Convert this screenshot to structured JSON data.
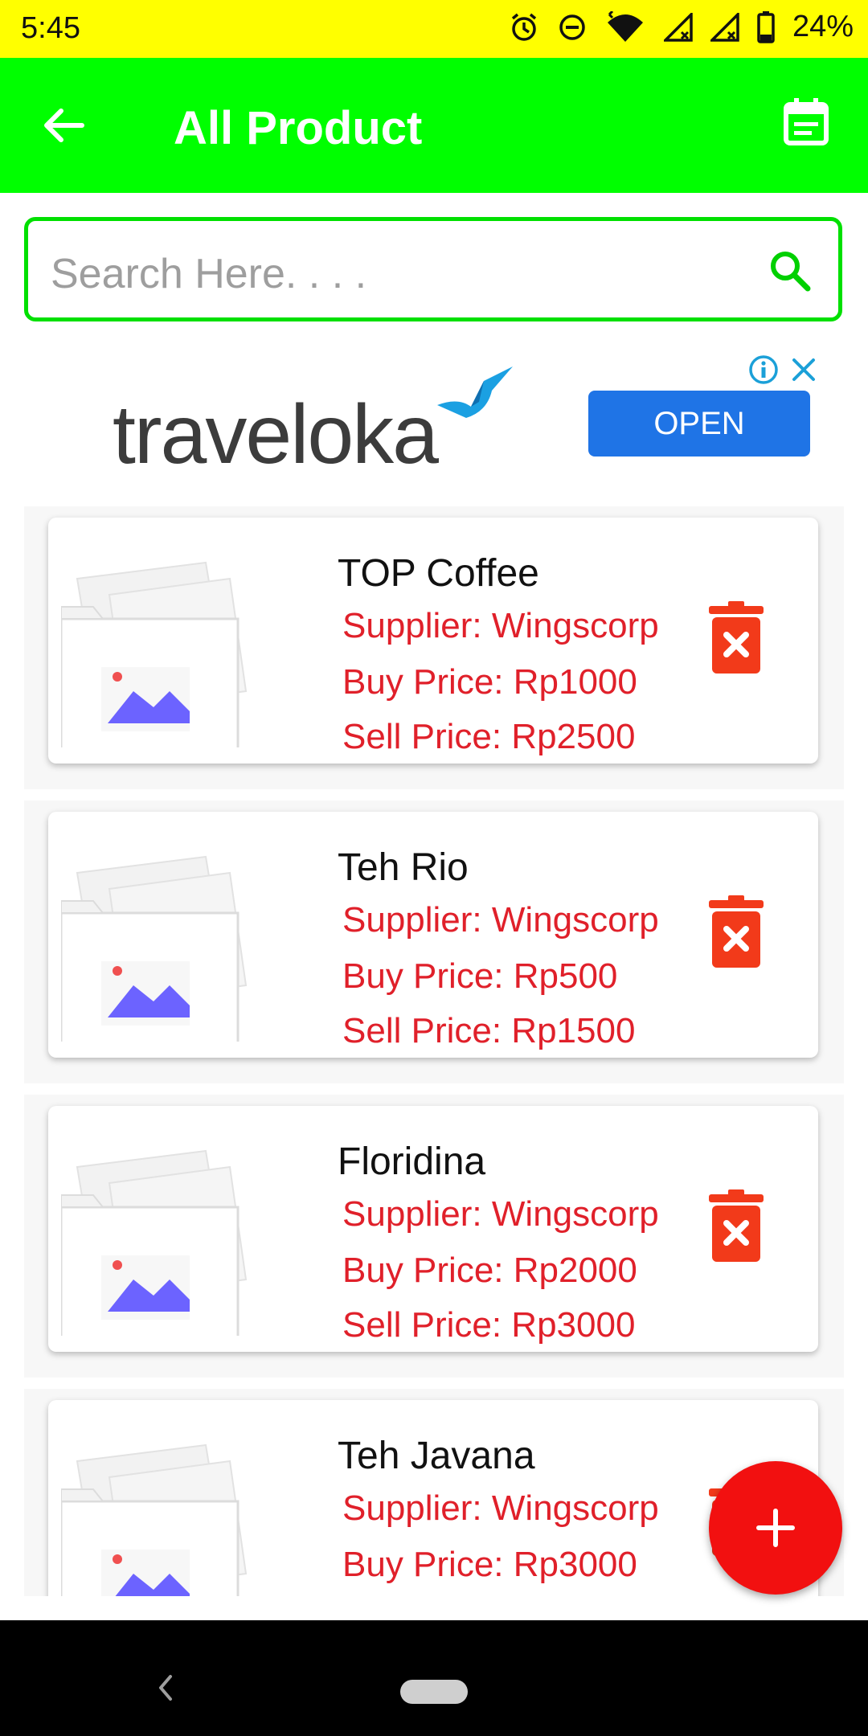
{
  "status_bar": {
    "time": "5:45",
    "battery": "24%"
  },
  "app_bar": {
    "title": "All Product",
    "back_icon": "arrow-back-icon",
    "action_icon": "calendar-list-icon",
    "bg_color": "#00ff00"
  },
  "search": {
    "placeholder": "Search Here. . . ."
  },
  "ad": {
    "brand": "traveloka",
    "button_label": "OPEN"
  },
  "products": [
    {
      "name": "TOP Coffee",
      "supplier": "Supplier: Wingscorp",
      "buy_price": "Buy Price: Rp1000",
      "sell_price": "Sell Price: Rp2500"
    },
    {
      "name": "Teh Rio",
      "supplier": "Supplier: Wingscorp",
      "buy_price": "Buy Price: Rp500",
      "sell_price": "Sell Price: Rp1500"
    },
    {
      "name": "Floridina",
      "supplier": "Supplier: Wingscorp",
      "buy_price": "Buy Price: Rp2000",
      "sell_price": "Sell Price: Rp3000"
    },
    {
      "name": "Teh Javana",
      "supplier": "Supplier: Wingscorp",
      "buy_price": "Buy Price: Rp3000",
      "sell_price": ""
    }
  ],
  "fab": {
    "icon": "plus-icon"
  },
  "colors": {
    "accent": "#00ff00",
    "price_text": "#e0202a",
    "delete": "#f23a1a",
    "fab": "#f21010"
  }
}
